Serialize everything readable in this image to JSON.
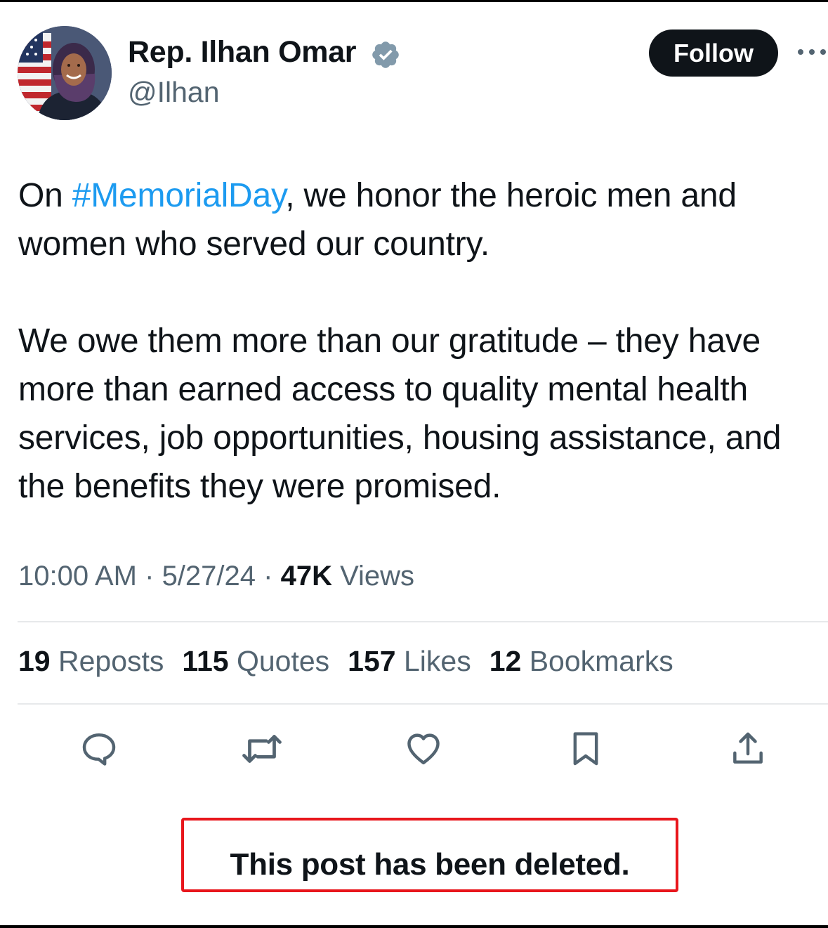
{
  "author": {
    "display_name": "Rep. Ilhan Omar",
    "handle": "@Ilhan",
    "verified_icon": "verified-badge-icon",
    "verified_color": "#829aab"
  },
  "header": {
    "follow_label": "Follow",
    "more_icon": "more-horizontal-icon"
  },
  "tweet": {
    "p1_before": "On ",
    "p1_hashtag": "#MemorialDay",
    "p1_after": ", we honor the heroic men and women who served our country.",
    "p2": "We owe them more than our gratitude – they have more than earned access to quality mental health services, job opportunities, housing assistance, and the benefits they were promised.",
    "hashtag_color": "#1d9bf0"
  },
  "meta": {
    "time": "10:00 AM",
    "sep1": " · ",
    "date": "5/27/24",
    "sep2": " · ",
    "views_count": "47K",
    "views_label": " Views"
  },
  "stats": [
    {
      "count": "19",
      "label": " Reposts"
    },
    {
      "count": "115",
      "label": " Quotes"
    },
    {
      "count": "157",
      "label": " Likes"
    },
    {
      "count": "12",
      "label": " Bookmarks"
    }
  ],
  "actions": [
    "reply-icon",
    "repost-icon",
    "like-icon",
    "bookmark-icon",
    "share-icon"
  ],
  "notice": {
    "text": "This post has been deleted.",
    "border_color": "#e8161c"
  }
}
